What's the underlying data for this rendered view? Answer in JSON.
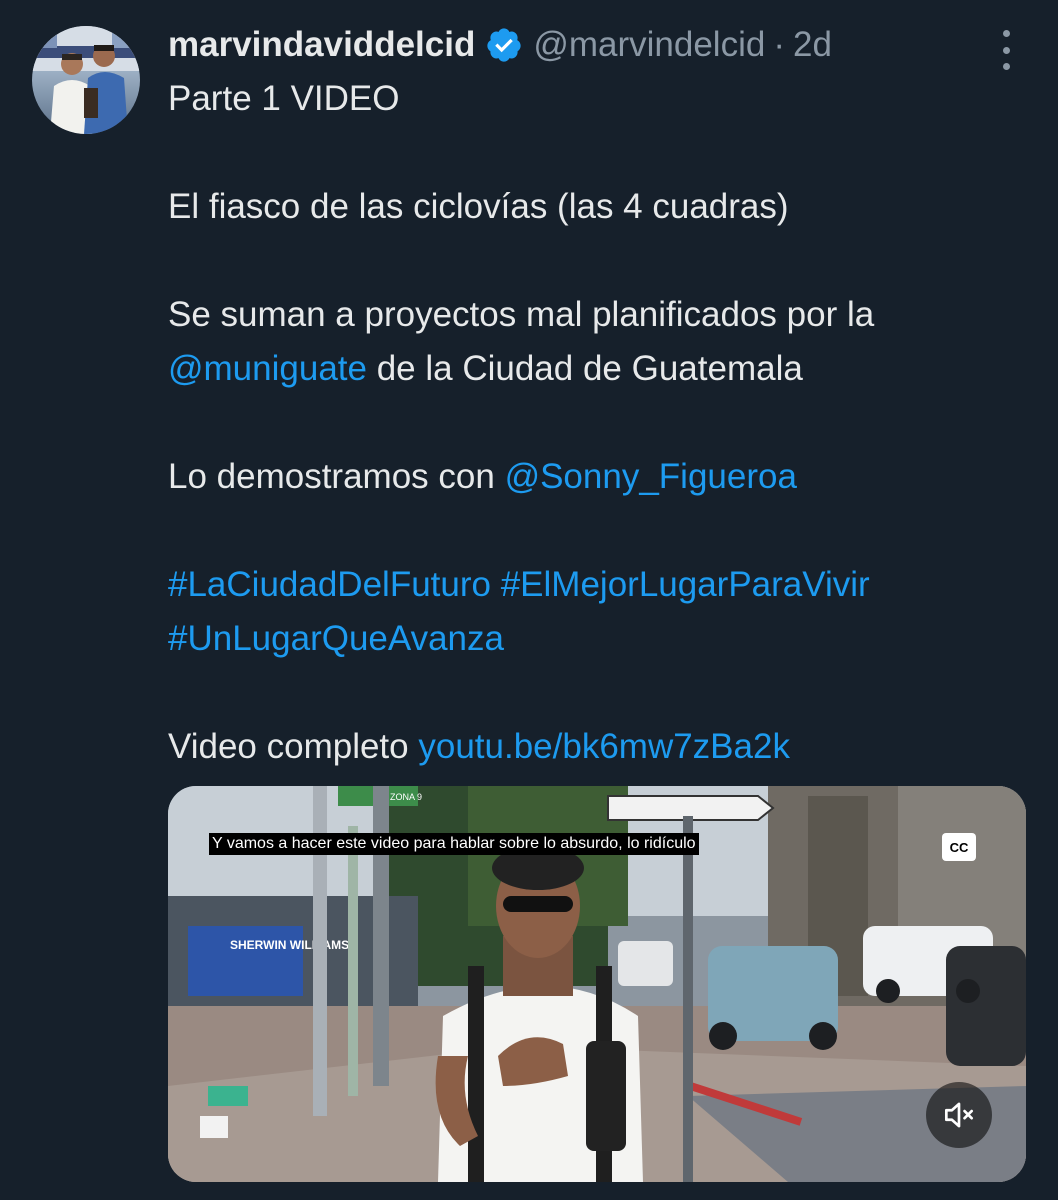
{
  "author": {
    "display_name": "marvindaviddelcid",
    "handle": "@marvindelcid",
    "separator": "·",
    "age": "2d",
    "verified_icon": "verified-badge-icon",
    "brand_color": "#1d9bf0"
  },
  "tweet": {
    "line1": "Parte 1 VIDEO",
    "line2": "El fiasco de las ciclovías (las 4 cuadras)",
    "line3_text": "Se suman a proyectos mal planificados por la",
    "line4_mention": "@muniguate",
    "line4_text": " de la Ciudad de Guatemala",
    "line5_text": "Lo demostramos con ",
    "line5_mention": "@Sonny_Figueroa",
    "hashtag1": "#LaCiudadDelFuturo",
    "hashtag2": "#ElMejorLugarParaVivir",
    "hashtag3": "#UnLugarQueAvanza",
    "line8_text": "Video completo ",
    "line8_link": "youtu.be/bk6mw7zBa2k"
  },
  "video": {
    "caption": "Y vamos a hacer este video para hablar sobre lo absurdo, lo ridículo",
    "cc_label": "CC",
    "mute_icon": "speaker-muted-icon",
    "sign_text": "ZONA 9",
    "billboard_text": "SHERWIN WILLIAMS"
  }
}
